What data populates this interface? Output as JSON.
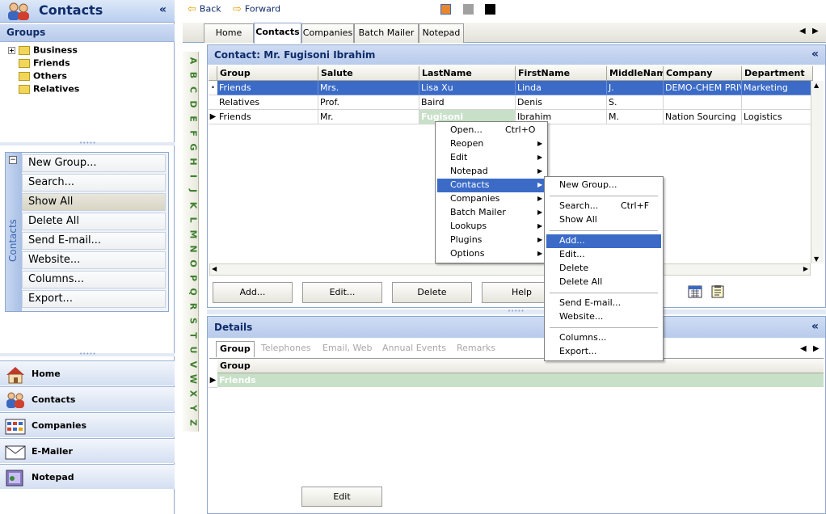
{
  "left": {
    "title": "Contacts",
    "collapse": "«",
    "groups_header": "Groups",
    "tree": [
      {
        "label": "Business",
        "expandable": true
      },
      {
        "label": "Friends",
        "expandable": false
      },
      {
        "label": "Others",
        "expandable": false
      },
      {
        "label": "Relatives",
        "expandable": false
      }
    ],
    "actions_title": "Contacts",
    "actions": [
      "New Group...",
      "Search...",
      "Show All",
      "Delete All",
      "Send E-mail...",
      "Website...",
      "Columns...",
      "Export..."
    ],
    "actions_selected": "Show All",
    "nav": [
      "Home",
      "Contacts",
      "Companies",
      "E-Mailer",
      "Notepad"
    ]
  },
  "toolbar": {
    "back": "Back",
    "forward": "Forward",
    "colors": [
      "#e8882c",
      "#a0a0a0",
      "#000000"
    ]
  },
  "tabs": [
    "Home",
    "Contacts",
    "Companies",
    "Batch Mailer",
    "Notepad"
  ],
  "active_tab": "Contacts",
  "alphabet": [
    "A",
    "B",
    "C",
    "D",
    "E",
    "F",
    "G",
    "H",
    "I",
    "J",
    "K",
    "L",
    "M",
    "N",
    "O",
    "P",
    "Q",
    "R",
    "S",
    "T",
    "U",
    "V",
    "W",
    "X",
    "Y",
    "Z"
  ],
  "contact": {
    "title": "Contact: Mr. Fugisoni Ibrahim",
    "collapse": "«",
    "columns": [
      "Group",
      "Salute",
      "LastName",
      "FirstName",
      "MiddleName",
      "Company",
      "Department"
    ],
    "rows": [
      [
        "Friends",
        "Mrs.",
        "Lisa Xu",
        "Linda",
        "J.",
        "DEMO-CHEM PRIVA",
        "Marketing"
      ],
      [
        "Relatives",
        "Prof.",
        "Baird",
        "Denis",
        "S.",
        "",
        ""
      ],
      [
        "Friends",
        "Mr.",
        "Fugisoni",
        "Ibrahim",
        "M.",
        "Nation Sourcing",
        "Logistics"
      ]
    ],
    "buttons": [
      "Add...",
      "Edit...",
      "Delete",
      "Help"
    ]
  },
  "details": {
    "title": "Details",
    "collapse": "«",
    "tabs": [
      "Group",
      "Telephones",
      "Email, Web",
      "Annual Events",
      "Remarks"
    ],
    "active_tab": "Group",
    "column": "Group",
    "row": "Friends",
    "edit_button": "Edit"
  },
  "context_menu": [
    {
      "label": "Open...",
      "shortcut": "Ctrl+O",
      "sub": false
    },
    {
      "label": "Reopen",
      "shortcut": "",
      "sub": true
    },
    {
      "label": "Edit",
      "shortcut": "",
      "sub": true
    },
    {
      "label": "Notepad",
      "shortcut": "",
      "sub": true
    },
    {
      "label": "Contacts",
      "shortcut": "",
      "sub": true
    },
    {
      "label": "Companies",
      "shortcut": "",
      "sub": true
    },
    {
      "label": "Batch Mailer",
      "shortcut": "",
      "sub": true
    },
    {
      "label": "Lookups",
      "shortcut": "",
      "sub": true
    },
    {
      "label": "Plugins",
      "shortcut": "",
      "sub": true
    },
    {
      "label": "Options",
      "shortcut": "",
      "sub": true
    }
  ],
  "context_menu_highlight": "Contacts",
  "submenu": [
    {
      "label": "New Group...",
      "shortcut": ""
    },
    {
      "label": "Search...",
      "shortcut": "Ctrl+F"
    },
    {
      "label": "Show All",
      "shortcut": ""
    },
    {
      "label": "Add...",
      "shortcut": ""
    },
    {
      "label": "Edit...",
      "shortcut": ""
    },
    {
      "label": "Delete",
      "shortcut": ""
    },
    {
      "label": "Delete All",
      "shortcut": ""
    },
    {
      "label": "Send E-mail...",
      "shortcut": ""
    },
    {
      "label": "Website...",
      "shortcut": ""
    },
    {
      "label": "Columns...",
      "shortcut": ""
    },
    {
      "label": "Export...",
      "shortcut": ""
    }
  ],
  "submenu_highlight": "Add..."
}
